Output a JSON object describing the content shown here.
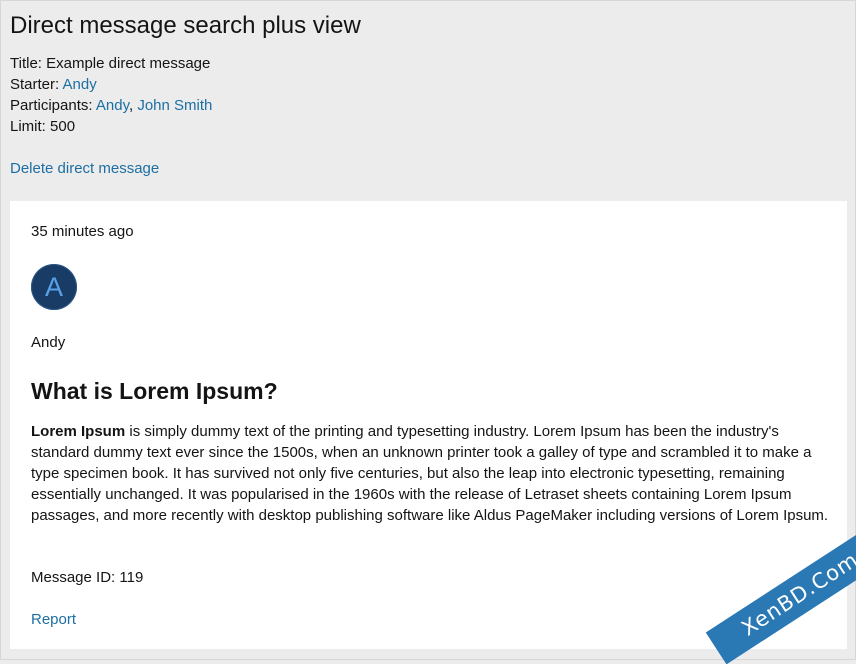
{
  "page": {
    "title": "Direct message search plus view"
  },
  "meta": {
    "title_label": "Title:",
    "title_value": "Example direct message",
    "starter_label": "Starter:",
    "starter_value": "Andy",
    "participants_label": "Participants:",
    "participants": [
      "Andy",
      "John Smith"
    ],
    "participants_separator": ",",
    "limit_label": "Limit:",
    "limit_value": "500"
  },
  "actions": {
    "delete_label": "Delete direct message"
  },
  "message": {
    "timestamp": "35 minutes ago",
    "avatar_letter": "A",
    "author": "Andy",
    "heading": "What is Lorem Ipsum?",
    "body_bold": "Lorem Ipsum",
    "body_rest": " is simply dummy text of the printing and typesetting industry. Lorem Ipsum has been the industry's standard dummy text ever since the 1500s, when an unknown printer took a galley of type and scrambled it to make a type specimen book. It has survived not only five centuries, but also the leap into electronic typesetting, remaining essentially unchanged. It was popularised in the 1960s with the release of Letraset sheets containing Lorem Ipsum passages, and more recently with desktop publishing software like Aldus PageMaker including versions of Lorem Ipsum.",
    "message_id_label": "Message ID:",
    "message_id": "119",
    "report_label": "Report"
  },
  "watermark": {
    "text": "XenBD.Com"
  },
  "colors": {
    "link": "#1d6fa3",
    "page_background": "#ececec",
    "card_background": "#ffffff",
    "avatar_background": "#183c66",
    "avatar_letter": "#5aa0e6",
    "watermark_background": "#2a78b4"
  }
}
